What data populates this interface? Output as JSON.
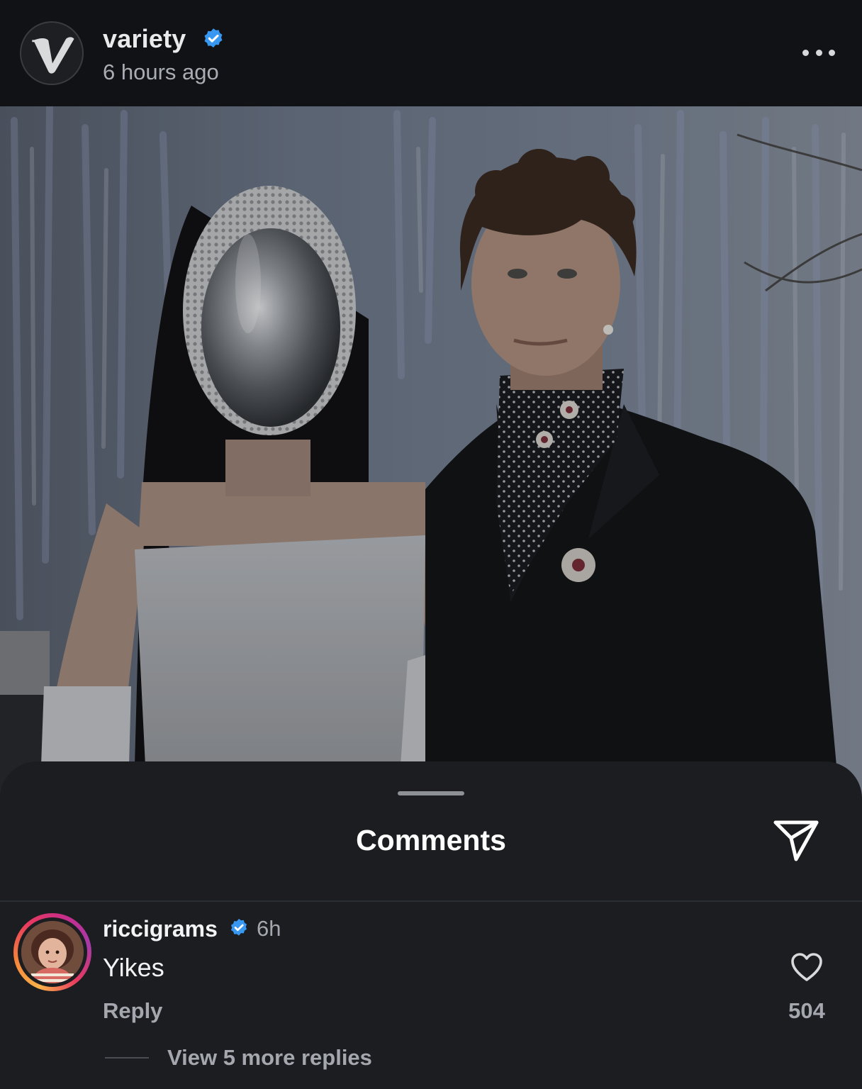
{
  "post": {
    "username": "variety",
    "verified": true,
    "time_ago": "6 hours ago",
    "more_icon": "more-horizontal-icon"
  },
  "comments_sheet": {
    "title": "Comments",
    "share_icon": "send-icon"
  },
  "comments": [
    {
      "username": "riccigrams",
      "verified": true,
      "time": "6h",
      "text": "Yikes",
      "reply_label": "Reply",
      "like_count": "504",
      "view_replies": "View 5 more replies"
    }
  ],
  "colors": {
    "verified_blue": "#3897f0",
    "sheet_background": "#1b1d21",
    "header_background": "#101215",
    "muted_text": "#a4a8ae"
  }
}
